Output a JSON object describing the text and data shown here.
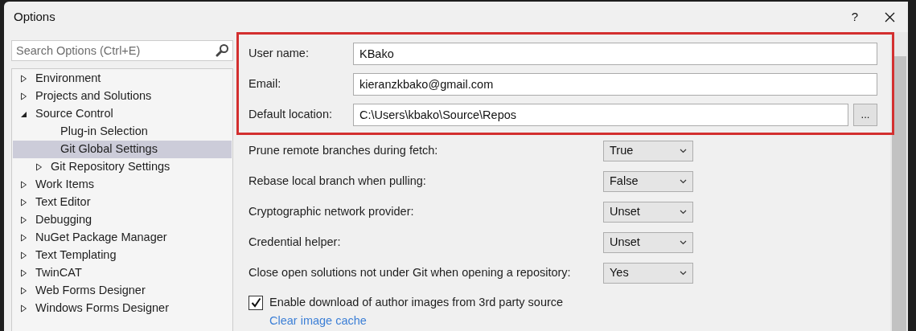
{
  "window": {
    "title": "Options",
    "help": "?"
  },
  "search": {
    "placeholder": "Search Options (Ctrl+E)"
  },
  "tree": [
    {
      "label": "Environment",
      "expanded": false,
      "selected": false
    },
    {
      "label": "Projects and Solutions",
      "expanded": false,
      "selected": false
    },
    {
      "label": "Source Control",
      "expanded": true,
      "selected": false,
      "children": [
        {
          "label": "Plug-in Selection",
          "selected": false
        },
        {
          "label": "Git Global Settings",
          "selected": true
        },
        {
          "label": "Git Repository Settings",
          "expanded": false,
          "selected": false
        }
      ]
    },
    {
      "label": "Work Items",
      "expanded": false,
      "selected": false
    },
    {
      "label": "Text Editor",
      "expanded": false,
      "selected": false
    },
    {
      "label": "Debugging",
      "expanded": false,
      "selected": false
    },
    {
      "label": "NuGet Package Manager",
      "expanded": false,
      "selected": false
    },
    {
      "label": "Text Templating",
      "expanded": false,
      "selected": false
    },
    {
      "label": "TwinCAT",
      "expanded": false,
      "selected": false
    },
    {
      "label": "Web Forms Designer",
      "expanded": false,
      "selected": false
    },
    {
      "label": "Windows Forms Designer",
      "expanded": false,
      "selected": false
    }
  ],
  "fields": [
    {
      "label": "User name:",
      "value": "KBako"
    },
    {
      "label": "Email:",
      "value": "kieranzkbako@gmail.com"
    },
    {
      "label": "Default location:",
      "value": "C:\\Users\\kbako\\Source\\Repos",
      "browse": "..."
    }
  ],
  "settings": [
    {
      "label": "Prune remote branches during fetch:",
      "value": "True"
    },
    {
      "label": "Rebase local branch when pulling:",
      "value": "False"
    },
    {
      "label": "Cryptographic network provider:",
      "value": "Unset"
    },
    {
      "label": "Credential helper:",
      "value": "Unset"
    },
    {
      "label": "Close open solutions not under Git when opening a repository:",
      "value": "Yes"
    }
  ],
  "checkbox": {
    "label": "Enable download of author images from 3rd party source",
    "checked": true
  },
  "link": "Clear image cache"
}
